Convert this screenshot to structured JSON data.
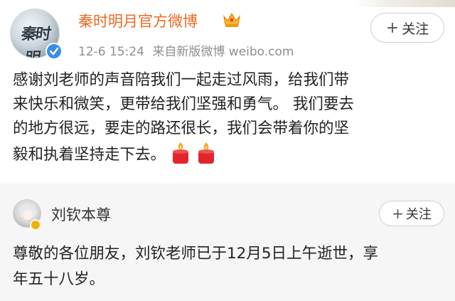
{
  "post": {
    "author_name": "秦时明月官方微博",
    "avatar_logo_text": "秦时明",
    "timestamp": "12-6 15:24",
    "source": "来自新版微博 weibo.com",
    "follow_label": "关注",
    "text_lines": [
      "感谢刘老师的声音陪我们一起走过风雨，给我们带",
      "来快乐和微笑，更带给我们坚强和勇气。 我们要去",
      "的地方很远，要走的路还很长，我们会带着你的坚",
      "毅和执着坚持走下去。"
    ],
    "emoji": [
      "candle-icon",
      "candle-icon"
    ],
    "badges": [
      "verified-icon",
      "crown-icon"
    ],
    "colors": {
      "author_name": "#ea6a20",
      "verified": "#3a8ee6"
    }
  },
  "repost": {
    "author_name": "刘钦本尊",
    "follow_label": "关注",
    "text_lines": [
      "尊敬的各位朋友，刘钦老师已于12月5日上午逝世，享",
      "年五十八岁。"
    ],
    "badges": [
      "vip-icon"
    ]
  }
}
